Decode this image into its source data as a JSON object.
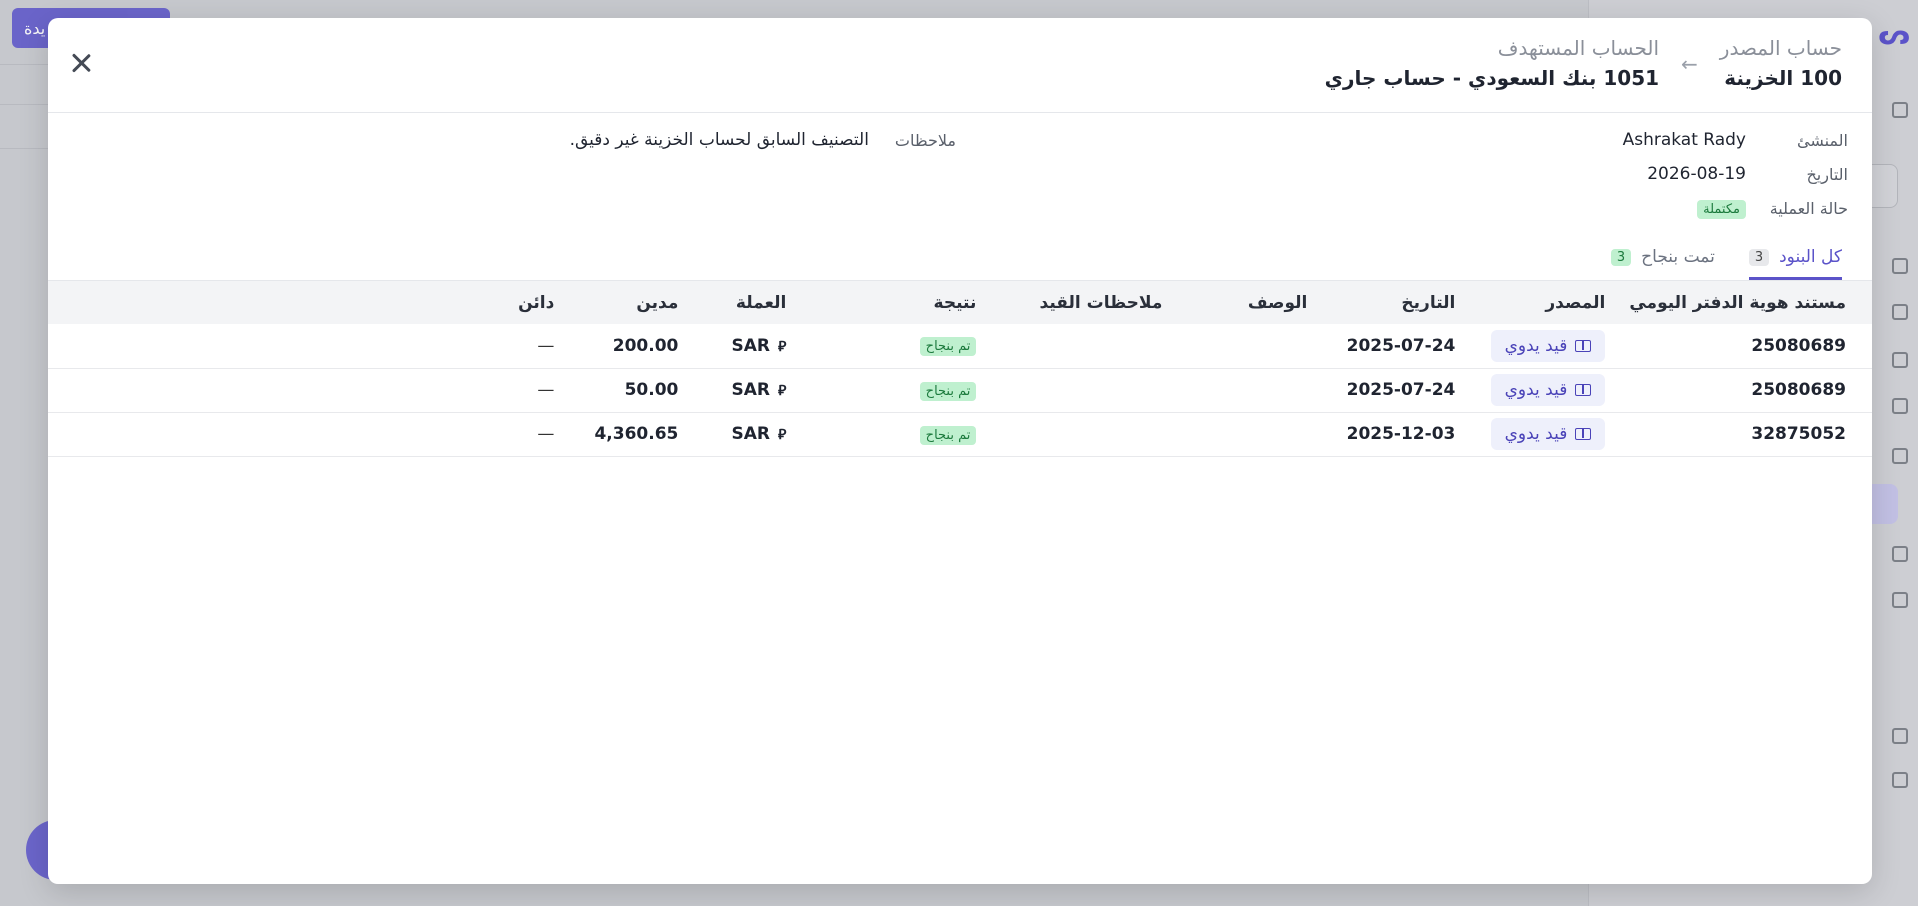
{
  "background": {
    "new_button_label": "يدة"
  },
  "modal": {
    "source_label": "حساب المصدر",
    "source_value": "100 الخزينة",
    "target_label": "الحساب المستهدف",
    "target_value": "1051 بنك السعودي - حساب جاري",
    "arrow": "←"
  },
  "meta": {
    "creator_key": "المنشئ",
    "creator_val": "Ashrakat Rady",
    "date_key": "التاريخ",
    "date_val": "2026-08-19",
    "status_key": "حالة العملية",
    "status_val": "مكتملة",
    "notes_key": "ملاحظات",
    "notes_val": "التصنيف السابق لحساب الخزينة غير دقيق."
  },
  "tabs": [
    {
      "label": "كل البنود",
      "count": "3"
    },
    {
      "label": "تمت بنجاح",
      "count": "3"
    }
  ],
  "table": {
    "headers": {
      "doc": "مستند هوية الدفتر اليومي",
      "source": "المصدر",
      "date": "التاريخ",
      "desc": "الوصف",
      "notes": "ملاحظات القيد",
      "result": "نتيجة",
      "currency": "العملة",
      "debit": "مدين",
      "credit": "دائن"
    },
    "rows": [
      {
        "doc": "25080689",
        "source": "قيد يدوي",
        "date": "2025-07-24",
        "desc": "",
        "notes": "",
        "result": "تم بنجاح",
        "currency": "SAR",
        "currency_symbol": "⃁",
        "debit": "200.00",
        "credit": "—"
      },
      {
        "doc": "25080689",
        "source": "قيد يدوي",
        "date": "2025-07-24",
        "desc": "",
        "notes": "",
        "result": "تم بنجاح",
        "currency": "SAR",
        "currency_symbol": "⃁",
        "debit": "50.00",
        "credit": "—"
      },
      {
        "doc": "32875052",
        "source": "قيد يدوي",
        "date": "2025-12-03",
        "desc": "",
        "notes": "",
        "result": "تم بنجاح",
        "currency": "SAR",
        "currency_symbol": "⃁",
        "debit": "4,360.65",
        "credit": "—"
      }
    ]
  },
  "colors": {
    "accent": "#5b53c9",
    "success_bg": "#bff0cf",
    "success_text": "#1c7a3d"
  },
  "icons": [
    "close-icon",
    "arrow-left-icon",
    "book-icon",
    "riyal-icon"
  ]
}
